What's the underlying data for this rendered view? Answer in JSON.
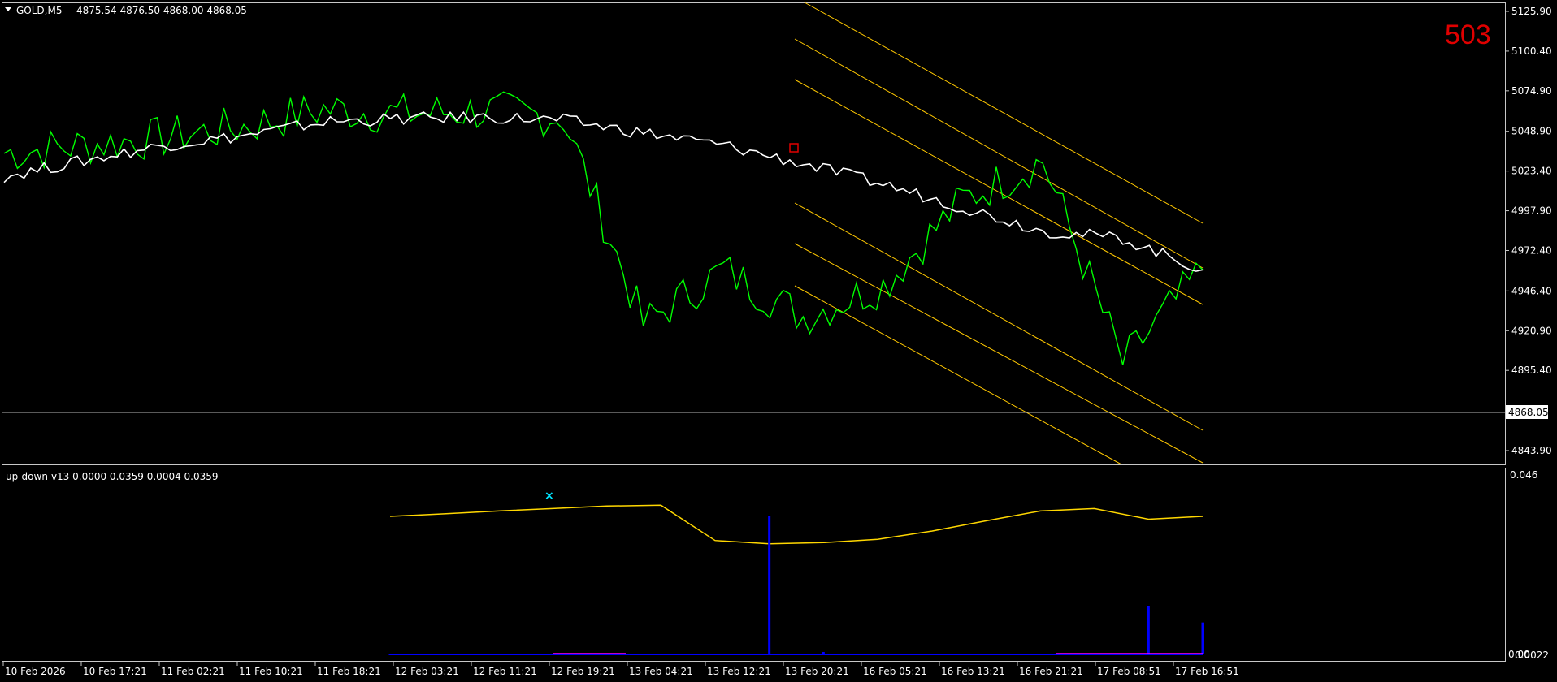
{
  "header": {
    "symbol": "GOLD,M5",
    "ohlc": "4875.54 4876.50 4868.00 4868.05",
    "badge": "503",
    "arrow_icon": "triangle-down-icon"
  },
  "indicator": {
    "label": "up-down-v13 0.0000 0.0359 0.0004 0.0359",
    "scale_top": "0.046",
    "scale_bottom_a": "0.00",
    "scale_bottom_b": "0.0022"
  },
  "current_price": "4868.05",
  "price_axis_labels": [
    "5125.90",
    "5100.40",
    "5074.90",
    "5048.90",
    "5023.40",
    "4997.90",
    "4972.40",
    "4946.40",
    "4920.90",
    "4895.40",
    "4843.90"
  ],
  "time_axis_labels": [
    "10 Feb 2026",
    "10 Feb 17:21",
    "11 Feb 02:21",
    "11 Feb 10:21",
    "11 Feb 18:21",
    "12 Feb 03:21",
    "12 Feb 11:21",
    "12 Feb 19:21",
    "13 Feb 04:21",
    "13 Feb 12:21",
    "13 Feb 20:21",
    "16 Feb 05:21",
    "16 Feb 13:21",
    "16 Feb 21:21",
    "17 Feb 08:51",
    "17 Feb 16:51"
  ],
  "colors": {
    "background": "#000000",
    "price_line": "#00ff00",
    "ma_line": "#ffffff",
    "channel": "#ffc800",
    "indicator_line": "#ffd700",
    "histogram": "#0000ff",
    "histogram_low": "#ff00ff",
    "badge": "#e00000"
  },
  "chart_data": {
    "type": "line",
    "title": "GOLD,M5",
    "ylim": [
      4835,
      5135
    ],
    "current": 4868.05,
    "x": [
      "10 Feb 2026",
      "10 Feb 17:21",
      "11 Feb 02:21",
      "11 Feb 10:21",
      "11 Feb 18:21",
      "12 Feb 03:21",
      "12 Feb 11:21",
      "12 Feb 19:21",
      "13 Feb 04:21",
      "13 Feb 12:21",
      "13 Feb 20:21",
      "16 Feb 05:21",
      "16 Feb 13:21",
      "16 Feb 21:21",
      "17 Feb 08:51",
      "17 Feb 16:51"
    ],
    "series": [
      {
        "values": [
          5035,
          5040,
          5045,
          5052,
          5063,
          5060,
          5062,
          5058,
          4925,
          4960,
          4930,
          4950,
          5005,
          5030,
          4900,
          4960
        ]
      },
      {
        "values": [
          5020,
          5030,
          5040,
          5046,
          5055,
          5057,
          5058,
          5056,
          5048,
          5040,
          5028,
          5015,
          5000,
          4985,
          4980,
          4960
        ]
      }
    ],
    "indicator": {
      "name": "up-down-v13",
      "ylim": [
        0.0022,
        0.046
      ],
      "line": [
        0.0359,
        0.0365,
        0.0372,
        0.0378,
        0.0384,
        0.0386,
        0.03,
        0.0292,
        0.0295,
        0.0303,
        0.0323,
        0.0348,
        0.0372,
        0.0378,
        0.0352,
        0.0359
      ],
      "histogram": [
        0.0022,
        0.0022,
        0.0022,
        0.0022,
        0.0022,
        0.0022,
        0.0022,
        0.036,
        0.0028,
        0.0023,
        0.0022,
        0.0022,
        0.0022,
        0.0022,
        0.014,
        0.01
      ]
    }
  }
}
